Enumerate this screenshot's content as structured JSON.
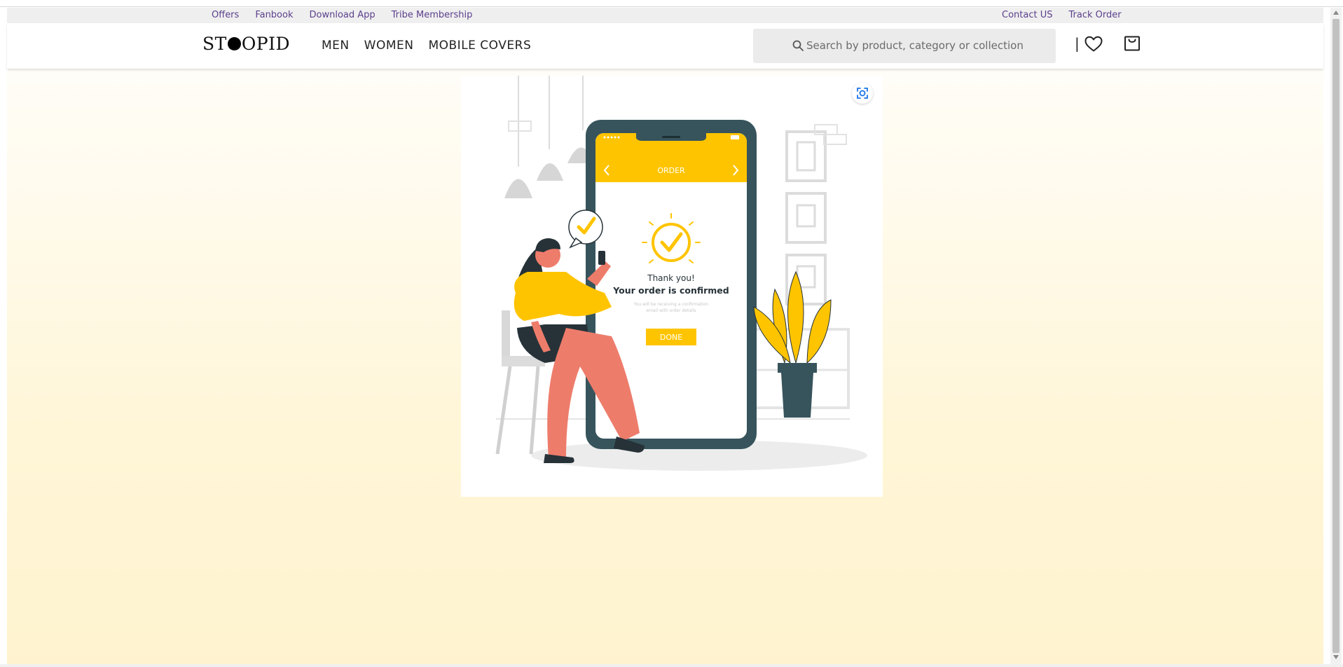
{
  "utility_bar": {
    "left_links": [
      "Offers",
      "Fanbook",
      "Download App",
      "Tribe Membership"
    ],
    "right_links": [
      "Contact US",
      "Track Order"
    ]
  },
  "header": {
    "logo": {
      "prefix": "ST",
      "suffix": "OPID"
    },
    "nav": [
      "MEN",
      "WOMEN",
      "MOBILE COVERS"
    ],
    "search": {
      "placeholder": "Search by product, category or collection",
      "value": ""
    },
    "divider": "|",
    "icons": [
      "search-icon",
      "heart-icon",
      "shopping-bag-icon"
    ]
  },
  "illustration": {
    "phone_header": "ORDER",
    "thank_you": "Thank you!",
    "confirmed": "Your order is confirmed",
    "fine_print_1": "You will be receiving a confirmation",
    "fine_print_2": "email with order details",
    "done_button": "DONE",
    "lens_icon": "visual-search-icon"
  },
  "colors": {
    "accent_yellow": "#FFC400",
    "phone_frame": "#37545C",
    "pants": "#EE7C6B",
    "link_purple": "#5b3f8c"
  }
}
